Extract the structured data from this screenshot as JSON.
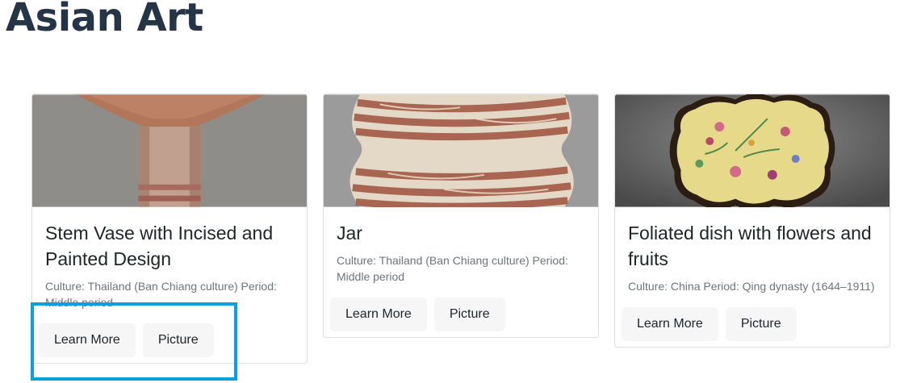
{
  "page": {
    "title": "Asian Art"
  },
  "cards": [
    {
      "title": "Stem Vase with Incised and Painted Design",
      "text": "Culture: Thailand (Ban Chiang culture) Period: Middle period",
      "learn_more": "Learn More",
      "picture": "Picture"
    },
    {
      "title": "Jar",
      "text": "Culture: Thailand (Ban Chiang culture) Period: Middle period",
      "learn_more": "Learn More",
      "picture": "Picture"
    },
    {
      "title": "Foliated dish with flowers and fruits",
      "text": "Culture: China Period: Qing dynasty (1644–1911)",
      "learn_more": "Learn More",
      "picture": "Picture"
    }
  ],
  "colors": {
    "title": "#253447",
    "focus_outline": "#0aa0dd",
    "button_bg": "#f6f6f6",
    "muted_text": "#6c757d"
  }
}
